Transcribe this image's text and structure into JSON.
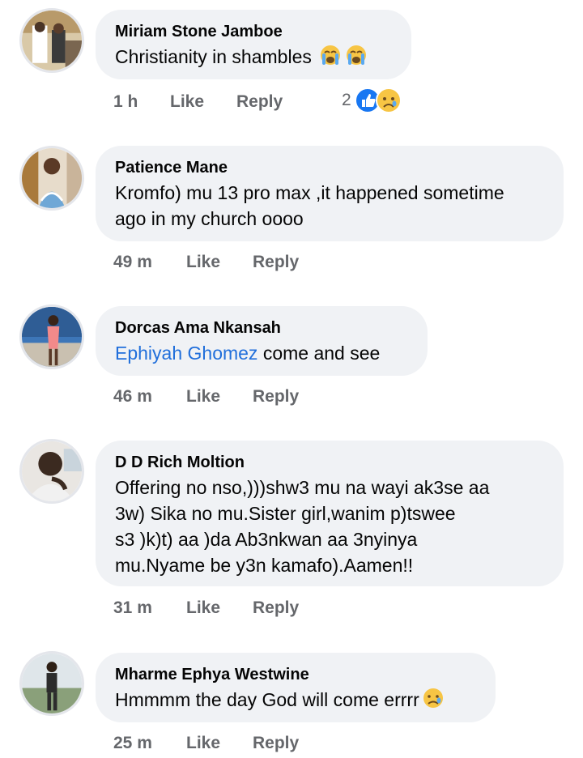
{
  "comments": [
    {
      "author": "Miriam Stone Jamboe",
      "text": "Christianity in shambles",
      "emoji": [
        "crying-face-icon",
        "crying-face-icon"
      ],
      "time": "1 h",
      "like": "Like",
      "reply": "Reply",
      "reaction_count": "2",
      "reactions": [
        "like-reaction-icon",
        "sad-reaction-icon"
      ]
    },
    {
      "author": "Patience Mane",
      "text_lines": [
        "Kromfo) mu 13 pro max ,it happened sometime",
        "ago in my church oooo"
      ],
      "time": "49 m",
      "like": "Like",
      "reply": "Reply"
    },
    {
      "author": "Dorcas Ama Nkansah",
      "mention": "Ephiyah Ghomez",
      "text": " come and see",
      "time": "46 m",
      "like": "Like",
      "reply": "Reply"
    },
    {
      "author": "D D Rich Moltion",
      "text_lines": [
        "Offering no nso,)))shw3 mu na wayi ak3se aa",
        "3w) Sika no mu.Sister girl,wanim p)tswee",
        "s3 )k)t) aa )da Ab3nkwan aa 3nyinya",
        "mu.Nyame be y3n kamafo).Aamen!!"
      ],
      "time": "31 m",
      "like": "Like",
      "reply": "Reply"
    },
    {
      "author": "Mharme Ephya Westwine",
      "text": "Hmmmm the day God will come errrr",
      "emoji": [
        "sad-tear-face-icon"
      ],
      "time": "25 m",
      "like": "Like",
      "reply": "Reply"
    }
  ],
  "colors": {
    "bubble": "#f0f2f5",
    "meta_text": "#65676b",
    "mention": "#216fdb",
    "like_blue": "#1877f2"
  }
}
